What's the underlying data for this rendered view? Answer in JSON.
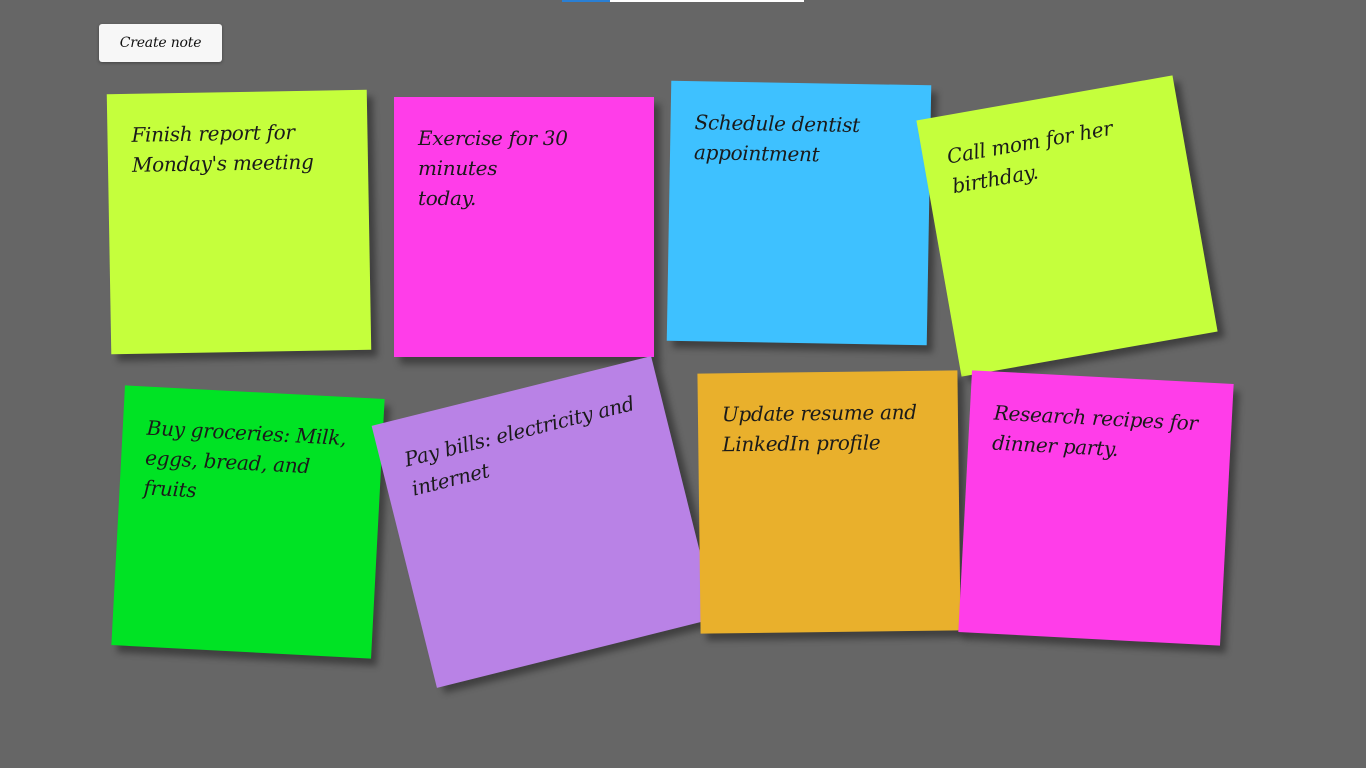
{
  "toolbar": {
    "create_label": "Create note"
  },
  "colors": {
    "background": "#666666",
    "lime": "#c5ff3c",
    "magenta": "#ff3de9",
    "sky": "#3ec1ff",
    "green": "#00e324",
    "lavender": "#b982e6",
    "amber": "#e9b02c"
  },
  "notes": [
    {
      "text": "Finish report for\nMonday's meeting",
      "color": "#c5ff3c"
    },
    {
      "text": "Exercise for 30 minutes\ntoday.",
      "color": "#ff3de9"
    },
    {
      "text": "Schedule dentist\nappointment",
      "color": "#3ec1ff"
    },
    {
      "text": "Call mom for her\nbirthday.",
      "color": "#c5ff3c"
    },
    {
      "text": "Buy groceries: Milk,\neggs, bread, and fruits",
      "color": "#00e324"
    },
    {
      "text": "Pay bills: electricity and\ninternet",
      "color": "#b982e6"
    },
    {
      "text": "Update resume and\nLinkedIn profile",
      "color": "#e9b02c"
    },
    {
      "text": "Research recipes for\ndinner party.",
      "color": "#ff3de9"
    }
  ]
}
